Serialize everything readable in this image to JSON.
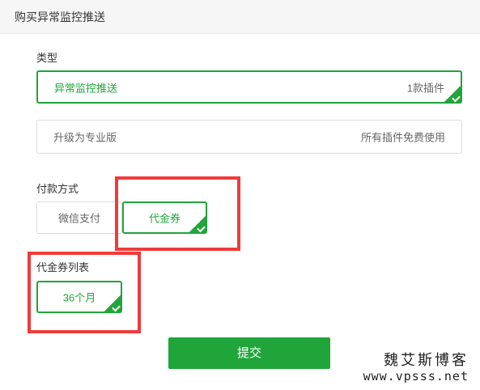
{
  "header": {
    "title": "购买异常监控推送"
  },
  "type_section": {
    "label": "类型",
    "options": [
      {
        "name": "异常监控推送",
        "detail": "1款插件",
        "selected": true
      },
      {
        "name": "升级为专业版",
        "detail": "所有插件免费使用",
        "selected": false
      }
    ]
  },
  "payment_section": {
    "label": "付款方式",
    "options": [
      {
        "name": "微信支付",
        "selected": false
      },
      {
        "name": "代金券",
        "selected": true
      }
    ]
  },
  "voucher_section": {
    "label": "代金券列表",
    "items": [
      {
        "name": "36个月",
        "selected": true
      }
    ]
  },
  "submit": {
    "label": "提交"
  },
  "watermark": {
    "line1": "魏艾斯博客",
    "line2": "www.vpsss.net"
  },
  "colors": {
    "accent": "#20a53a",
    "highlight": "#ef3b3b"
  }
}
